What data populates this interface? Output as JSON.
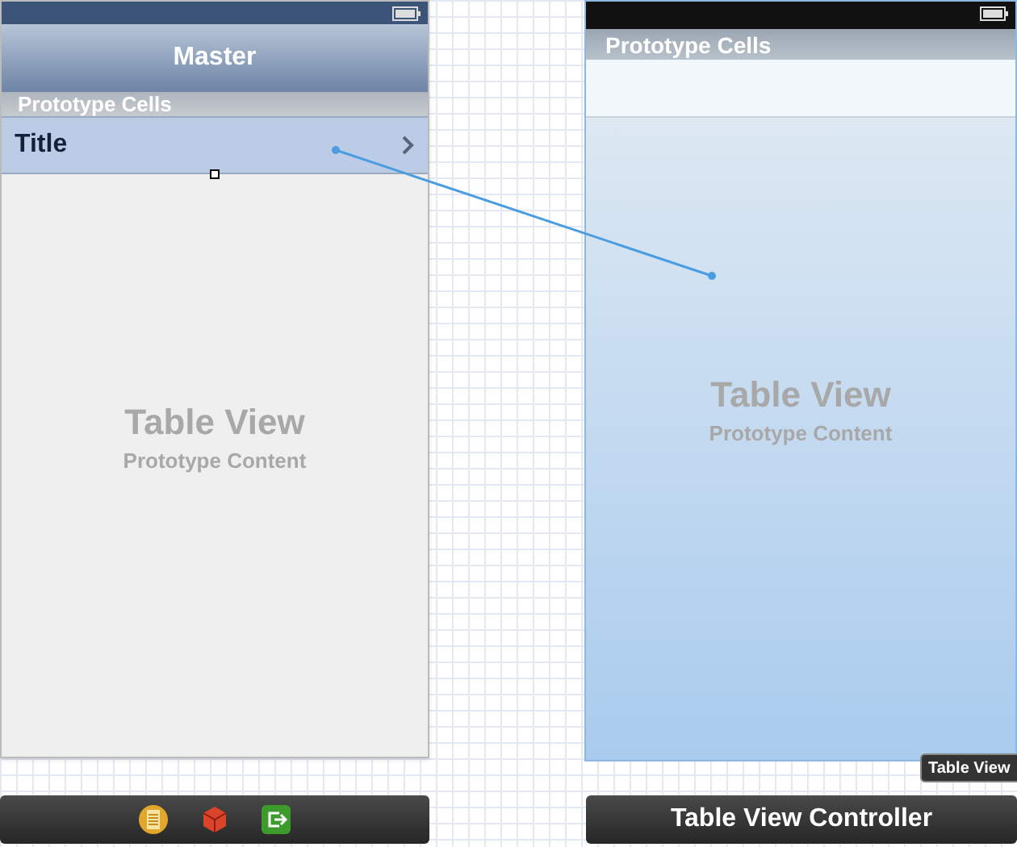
{
  "scenes": [
    {
      "kind": "master",
      "nav_title": "Master",
      "section_header": "Prototype Cells",
      "cell": {
        "title": "Title",
        "selected": true
      },
      "table_title": "Table View",
      "table_subtitle": "Prototype Content",
      "dock": {
        "kind": "icons"
      }
    },
    {
      "kind": "detail",
      "section_header": "Prototype Cells",
      "table_title": "Table View",
      "table_subtitle": "Prototype Content",
      "selected": true,
      "tooltip": "Table View",
      "dock": {
        "kind": "title",
        "title": "Table View Controller"
      }
    }
  ]
}
